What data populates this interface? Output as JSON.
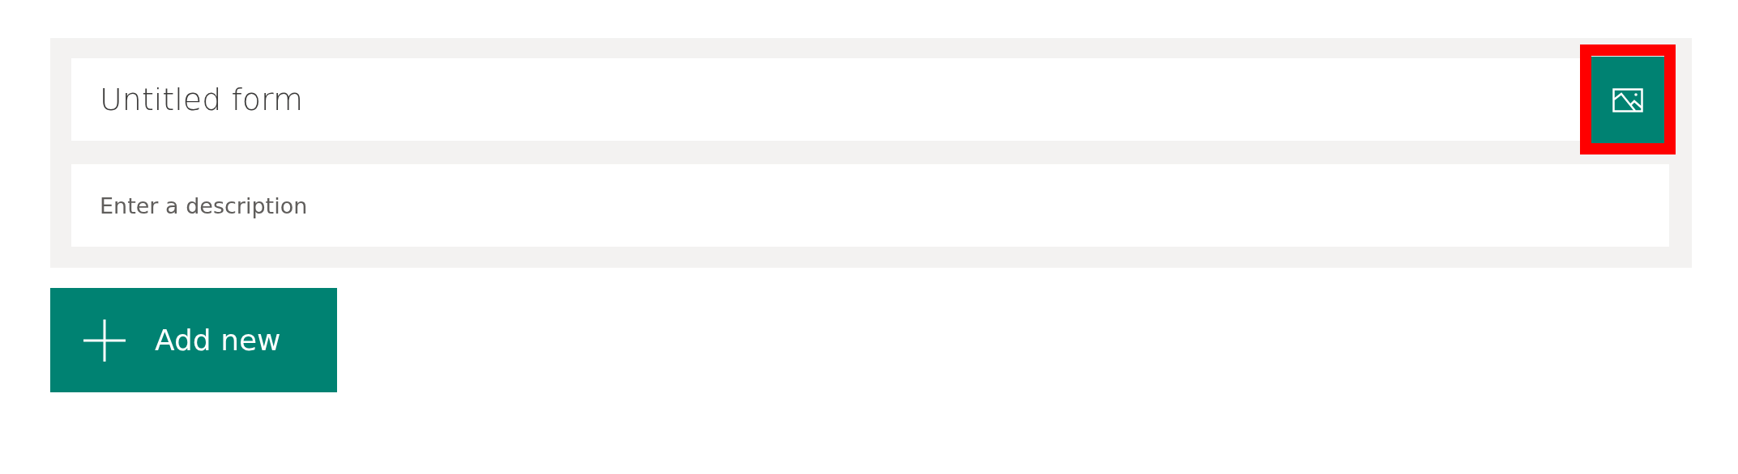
{
  "form_header": {
    "title": {
      "placeholder": "Untitled form"
    },
    "description": {
      "placeholder": "Enter a description"
    },
    "image_button": {
      "highlighted": true
    }
  },
  "add_button": {
    "label": "Add new"
  }
}
